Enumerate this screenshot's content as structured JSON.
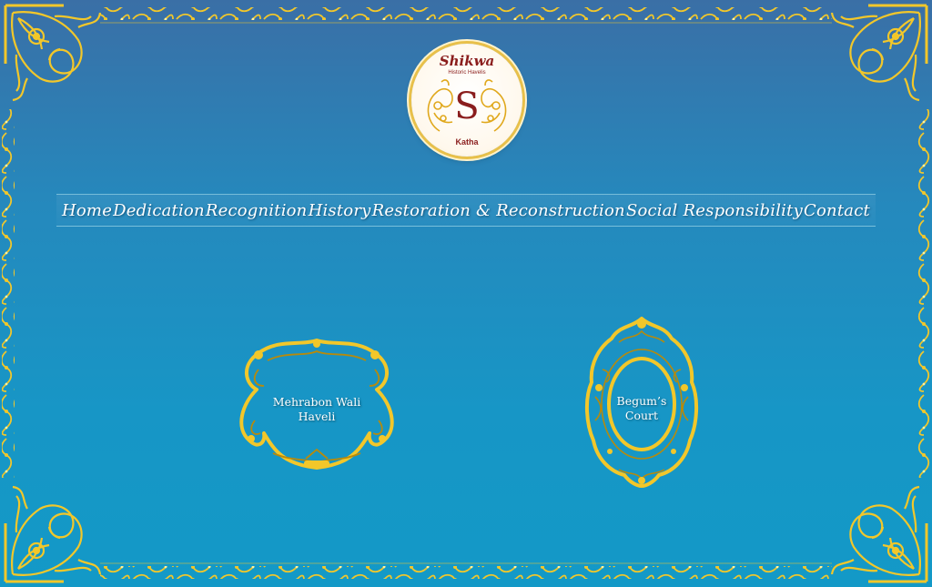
{
  "logo": {
    "title": "Shikwa",
    "subtitle": "Historic Havelis",
    "bottom": "Katha",
    "monogram": "S"
  },
  "nav": {
    "items": [
      {
        "label": "Home"
      },
      {
        "label": "Dedication"
      },
      {
        "label": "Recognition"
      },
      {
        "label": "History"
      },
      {
        "label": "Restoration & Reconstruction"
      },
      {
        "label": "Social Responsibility"
      },
      {
        "label": "Contact"
      }
    ]
  },
  "plaques": [
    {
      "line1": "Mehrabon Wali",
      "line2": "Haveli"
    },
    {
      "line1": "Begum’s",
      "line2": "Court"
    }
  ],
  "colors": {
    "gold": "#f2c72a",
    "gold_dark": "#b88a0a",
    "maroon": "#8a1d1d"
  }
}
